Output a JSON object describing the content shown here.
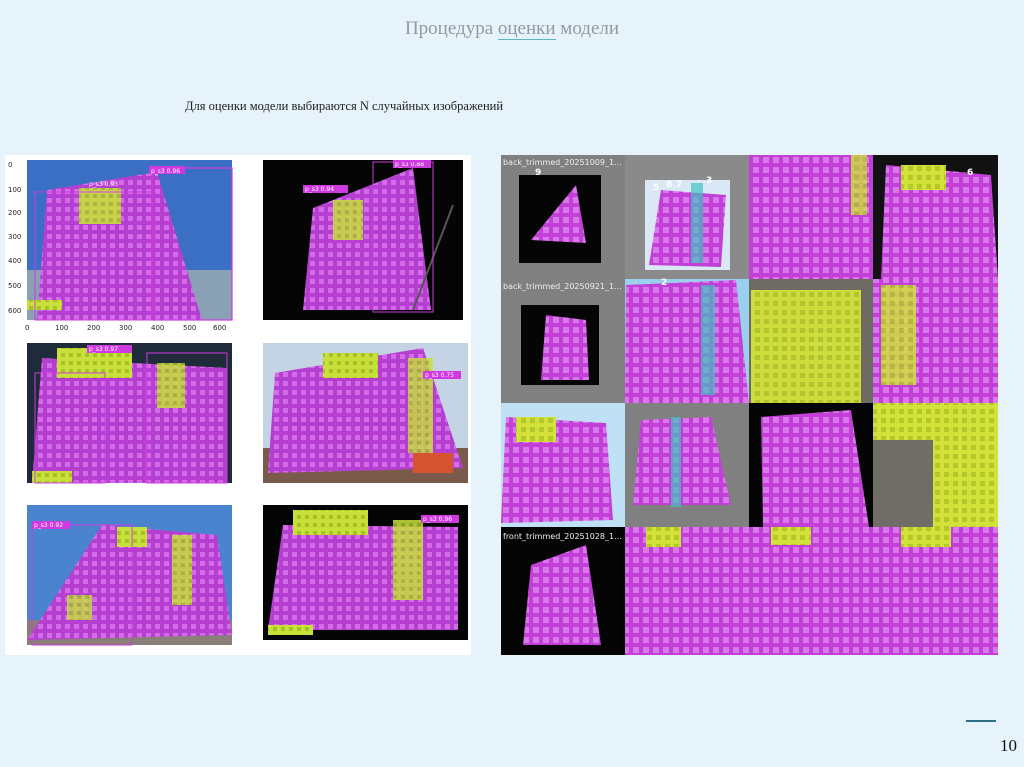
{
  "slide": {
    "title_part1": "Процедура ",
    "title_underlined": "оценки",
    "title_part3": " модели",
    "subtitle": "Для оценки модели выбираются N случайных изображений",
    "page_number": "10"
  },
  "plots": {
    "y_ticks": [
      "0",
      "100",
      "200",
      "300",
      "400",
      "500",
      "600"
    ],
    "x_ticks": [
      "0",
      "100",
      "200",
      "300",
      "400",
      "500",
      "600"
    ],
    "label_samples": [
      "p_s3 0.96",
      "p_s3 0.92",
      "p_s3 0.93",
      "p_s3 0.94",
      "p_s3 0.79",
      "p_s3 0.88",
      "p_s3 0.88",
      "p_s3 0.97",
      "p_s3 0.75",
      "p_s3 0.96"
    ]
  },
  "mosaic": {
    "captions": [
      "back_trimmed_20251009_1...",
      "back_trimmed_20250921_1...",
      "front_trimmed_20251028_1..."
    ],
    "class_labels": [
      "9",
      "5",
      "6",
      "2",
      "7",
      "3",
      "8"
    ]
  },
  "colors": {
    "facade": "#c23fd8",
    "balcony": "#c8e13a",
    "background": "#e6f3fb"
  }
}
